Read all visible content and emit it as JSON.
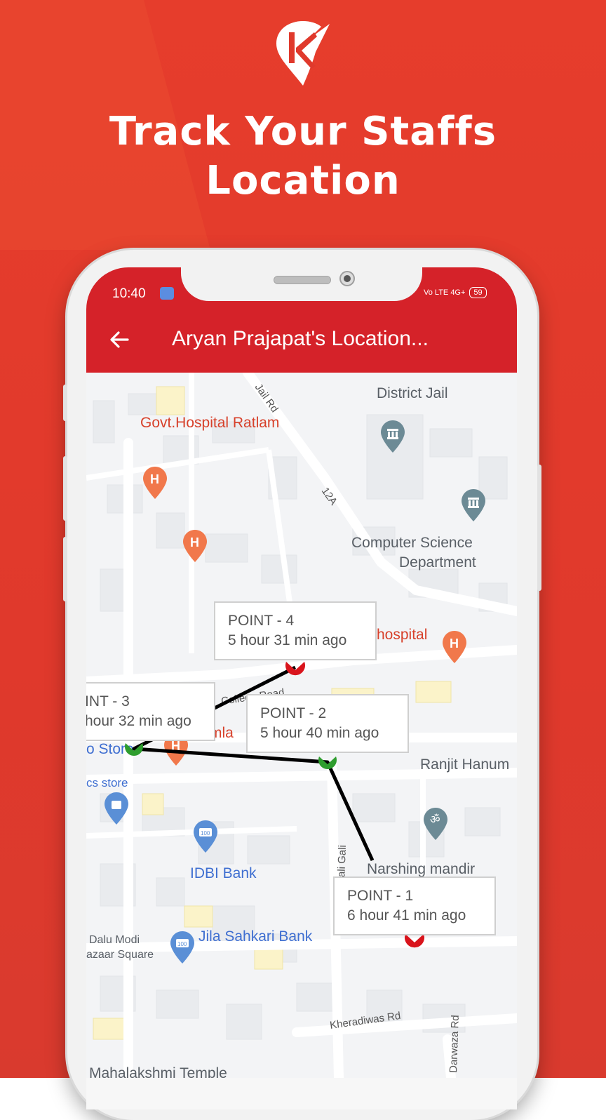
{
  "banner": {
    "headline_line1": "Track Your Staffs",
    "headline_line2": "Location"
  },
  "status_bar": {
    "time": "10:40",
    "network": "Vo LTE 4G+",
    "battery": "59"
  },
  "app_bar": {
    "title": "Aryan Prajapat's Location..."
  },
  "map": {
    "labels": {
      "district_jail": "District Jail",
      "govt_hospital": "Govt.Hospital Ratlam",
      "jail_rd": "Jail Rd",
      "road_12a": "12A",
      "computer_science_1": "Computer Science",
      "computer_science_2": "Department",
      "hospital": "hospital",
      "college_road": "College Road",
      "kamla": "mla",
      "store": "o Store",
      "ics_store": "cs store",
      "ranjit": "Ranjit Hanum",
      "narshing": "Narshing mandir",
      "idbi": "IDBI Bank",
      "jila_sahkari": "Jila Sahkari Bank",
      "dalu_modi_1": "Dalu Modi",
      "dalu_modi_2": "azaar Square",
      "kherdiwas": "Kheradiwas Rd",
      "darwaza": "Darwaza Rd",
      "wali_gali": "wali Gali",
      "mahalakshmi": "Mahalakshmi Temple",
      "bank_badge": "100"
    },
    "points": [
      {
        "label": "POINT - 4",
        "ago": "5 hour 31 min ago"
      },
      {
        "label": "INT - 3",
        "ago": "hour 32 min ago"
      },
      {
        "label": "POINT - 2",
        "ago": "5 hour 40 min ago"
      },
      {
        "label": "POINT - 1",
        "ago": "6 hour 41 min ago"
      }
    ]
  },
  "colors": {
    "brand_red": "#d52229",
    "background_red": "#e63d2c",
    "route": "#000000",
    "marker_green": "#2e9d2e",
    "marker_red": "#d9141c"
  },
  "icons": [
    "brand-logo-icon",
    "back-arrow-icon",
    "hospital-pin-icon",
    "museum-pin-icon",
    "temple-pin-icon",
    "bank-pin-icon",
    "shopping-pin-icon"
  ]
}
